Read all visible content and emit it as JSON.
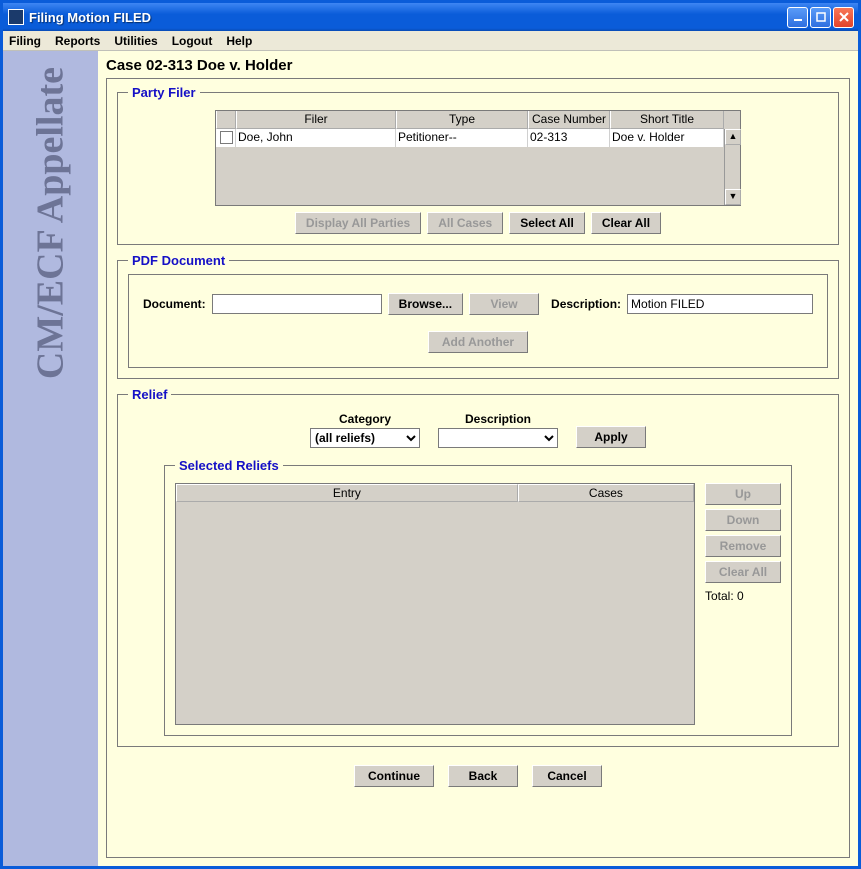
{
  "window": {
    "title": "Filing Motion FILED"
  },
  "menu": {
    "items": [
      "Filing",
      "Reports",
      "Utilities",
      "Logout",
      "Help"
    ]
  },
  "sidebar": {
    "brand": "CM/ECF Appellate"
  },
  "case": {
    "title": "Case 02-313 Doe v. Holder"
  },
  "partyFiler": {
    "legend": "Party Filer",
    "columns": {
      "filer": "Filer",
      "type": "Type",
      "caseNumber": "Case Number",
      "shortTitle": "Short Title"
    },
    "rows": [
      {
        "filer": "Doe, John",
        "type": "Petitioner--",
        "caseNumber": "02-313",
        "shortTitle": "Doe v. Holder",
        "checked": false
      }
    ],
    "buttons": {
      "displayAll": "Display All Parties",
      "allCases": "All Cases",
      "selectAll": "Select All",
      "clearAll": "Clear All"
    }
  },
  "pdf": {
    "legend": "PDF Document",
    "documentLabel": "Document:",
    "documentValue": "",
    "browse": "Browse...",
    "view": "View",
    "descriptionLabel": "Description:",
    "descriptionValue": "Motion FILED",
    "addAnother": "Add Another"
  },
  "relief": {
    "legend": "Relief",
    "categoryLabel": "Category",
    "categoryValue": "(all reliefs)",
    "descriptionLabel": "Description",
    "descriptionValue": "",
    "apply": "Apply"
  },
  "selectedReliefs": {
    "legend": "Selected Reliefs",
    "columns": {
      "entry": "Entry",
      "cases": "Cases"
    },
    "buttons": {
      "up": "Up",
      "down": "Down",
      "remove": "Remove",
      "clearAll": "Clear All"
    },
    "totalLabel": "Total: 0"
  },
  "footer": {
    "continue": "Continue",
    "back": "Back",
    "cancel": "Cancel"
  }
}
